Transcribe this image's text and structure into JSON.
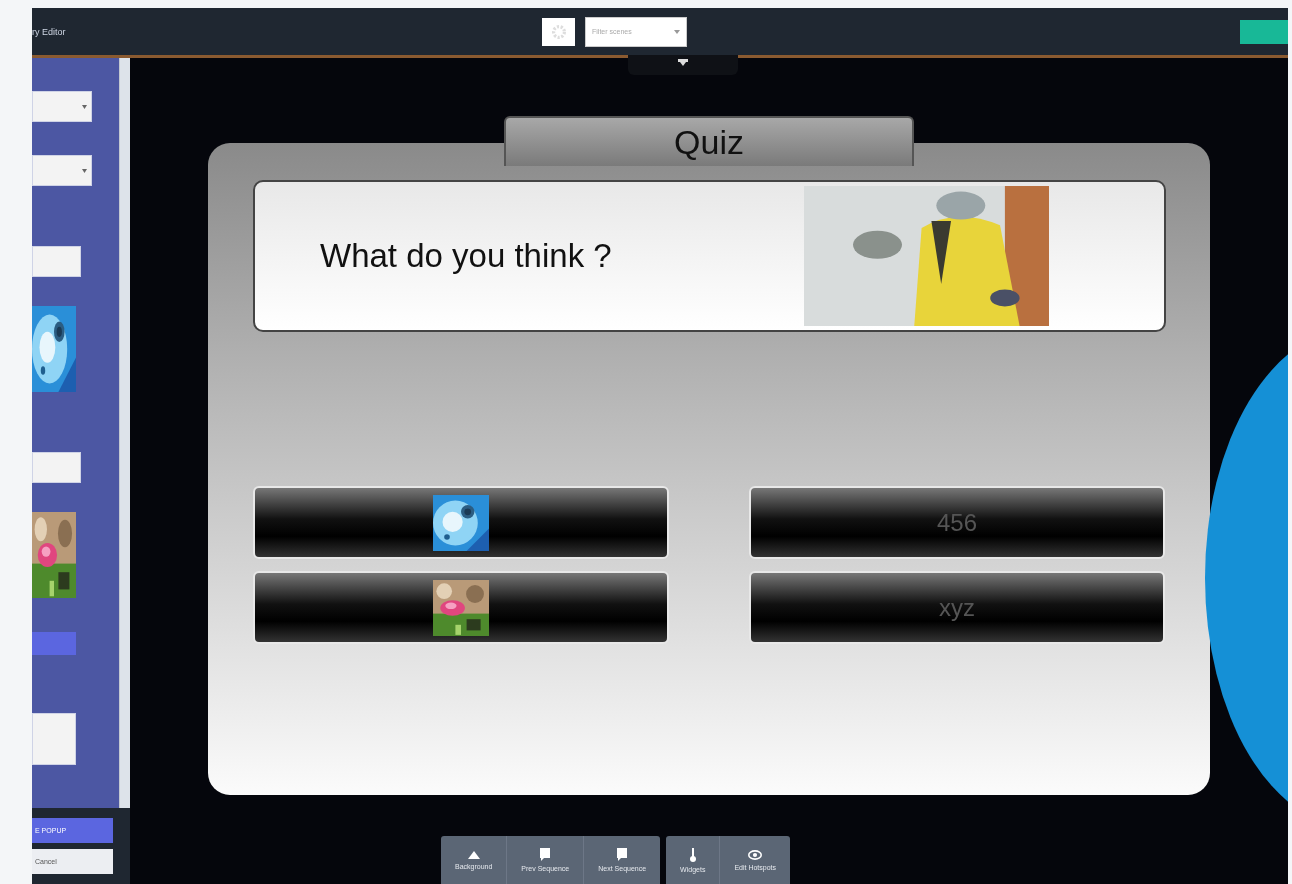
{
  "top_bar": {
    "title": "ry Editor",
    "select": {
      "placeholder": "Filter scenes"
    }
  },
  "sidebar": {
    "fields": [
      {
        "kind": "select"
      },
      {
        "kind": "select"
      },
      {
        "kind": "input"
      },
      {
        "kind": "picture"
      },
      {
        "kind": "input"
      },
      {
        "kind": "picture"
      },
      {
        "kind": "button"
      },
      {
        "kind": "textarea"
      }
    ],
    "buttons": [
      {
        "label": "E POPUP",
        "primary": true
      },
      {
        "label": "Cancel",
        "primary": false
      }
    ]
  },
  "quiz": {
    "title": "Quiz",
    "question": "What do you think ?",
    "answers": [
      {
        "kind": "picture"
      },
      {
        "kind": "text",
        "label": "456"
      },
      {
        "kind": "picture"
      },
      {
        "kind": "text",
        "label": "xyz"
      }
    ]
  },
  "toolbar": {
    "groups": [
      [
        {
          "label": "Background"
        },
        {
          "label": "Prev Sequence"
        },
        {
          "label": "Next Sequence"
        }
      ],
      [
        {
          "label": "Widgets"
        },
        {
          "label": "Edit Hotspots"
        }
      ]
    ]
  }
}
